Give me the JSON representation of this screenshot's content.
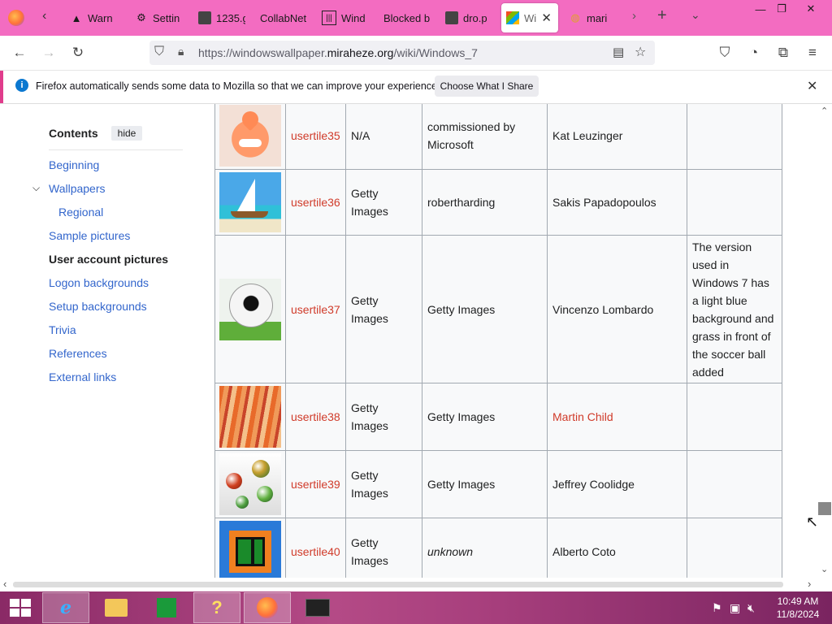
{
  "tabs": [
    {
      "label": "Warn",
      "icon": "warning-icon"
    },
    {
      "label": "Settin",
      "icon": "gear-icon"
    },
    {
      "label": "1235.g",
      "icon": "image-icon"
    },
    {
      "label": "CollabNet",
      "icon": ""
    },
    {
      "label": "Wind",
      "icon": "wiki-icon"
    },
    {
      "label": "Blocked b",
      "icon": ""
    },
    {
      "label": "dro.p",
      "icon": "image-icon"
    },
    {
      "label": "Wi",
      "icon": "windows-icon"
    },
    {
      "label": "mari",
      "icon": "mario-icon"
    }
  ],
  "url": {
    "prefix": "https://windowswallpaper.",
    "domain": "miraheze.org",
    "path": "/wiki/Windows_7"
  },
  "notification": {
    "message": "Firefox automatically sends some data to Mozilla so that we can improve your experience.",
    "button": "Choose What I Share"
  },
  "toc": {
    "title": "Contents",
    "hide": "hide",
    "items": [
      "Beginning",
      "Wallpapers",
      "Regional",
      "Sample pictures",
      "User account pictures",
      "Logon backgrounds",
      "Setup backgrounds",
      "Trivia",
      "References",
      "External links"
    ]
  },
  "rows": [
    {
      "name": "usertile35",
      "source": "N/A",
      "credit": "commissioned by Microsoft",
      "author": "Kat Leuzinger",
      "notes": "",
      "image": "orange-character"
    },
    {
      "name": "usertile36",
      "source": "Getty Images",
      "credit": "robertharding",
      "author": "Sakis Papadopoulos",
      "notes": "",
      "image": "sailboat"
    },
    {
      "name": "usertile37",
      "source": "Getty Images",
      "credit": "Getty Images",
      "author": "Vincenzo Lombardo",
      "notes": "The version used in Windows 7 has a light blue background and grass in front of the soccer ball added",
      "image": "soccer-ball"
    },
    {
      "name": "usertile38",
      "source": "Getty Images",
      "credit": "Getty Images",
      "author": "Martin Child",
      "notes": "",
      "image": "fabric"
    },
    {
      "name": "usertile39",
      "source": "Getty Images",
      "credit": "Getty Images",
      "author": "Jeffrey Coolidge",
      "notes": "",
      "image": "marbles"
    },
    {
      "name": "usertile40",
      "source": "Getty Images",
      "credit": "unknown",
      "author": "Alberto Coto",
      "notes": "",
      "image": "window"
    }
  ],
  "clock": {
    "time": "10:49 AM",
    "date": "11/8/2024"
  },
  "colors": {
    "tabstrip": "#f36cc1",
    "link": "#3366cc",
    "redlink": "#d03b2a"
  }
}
